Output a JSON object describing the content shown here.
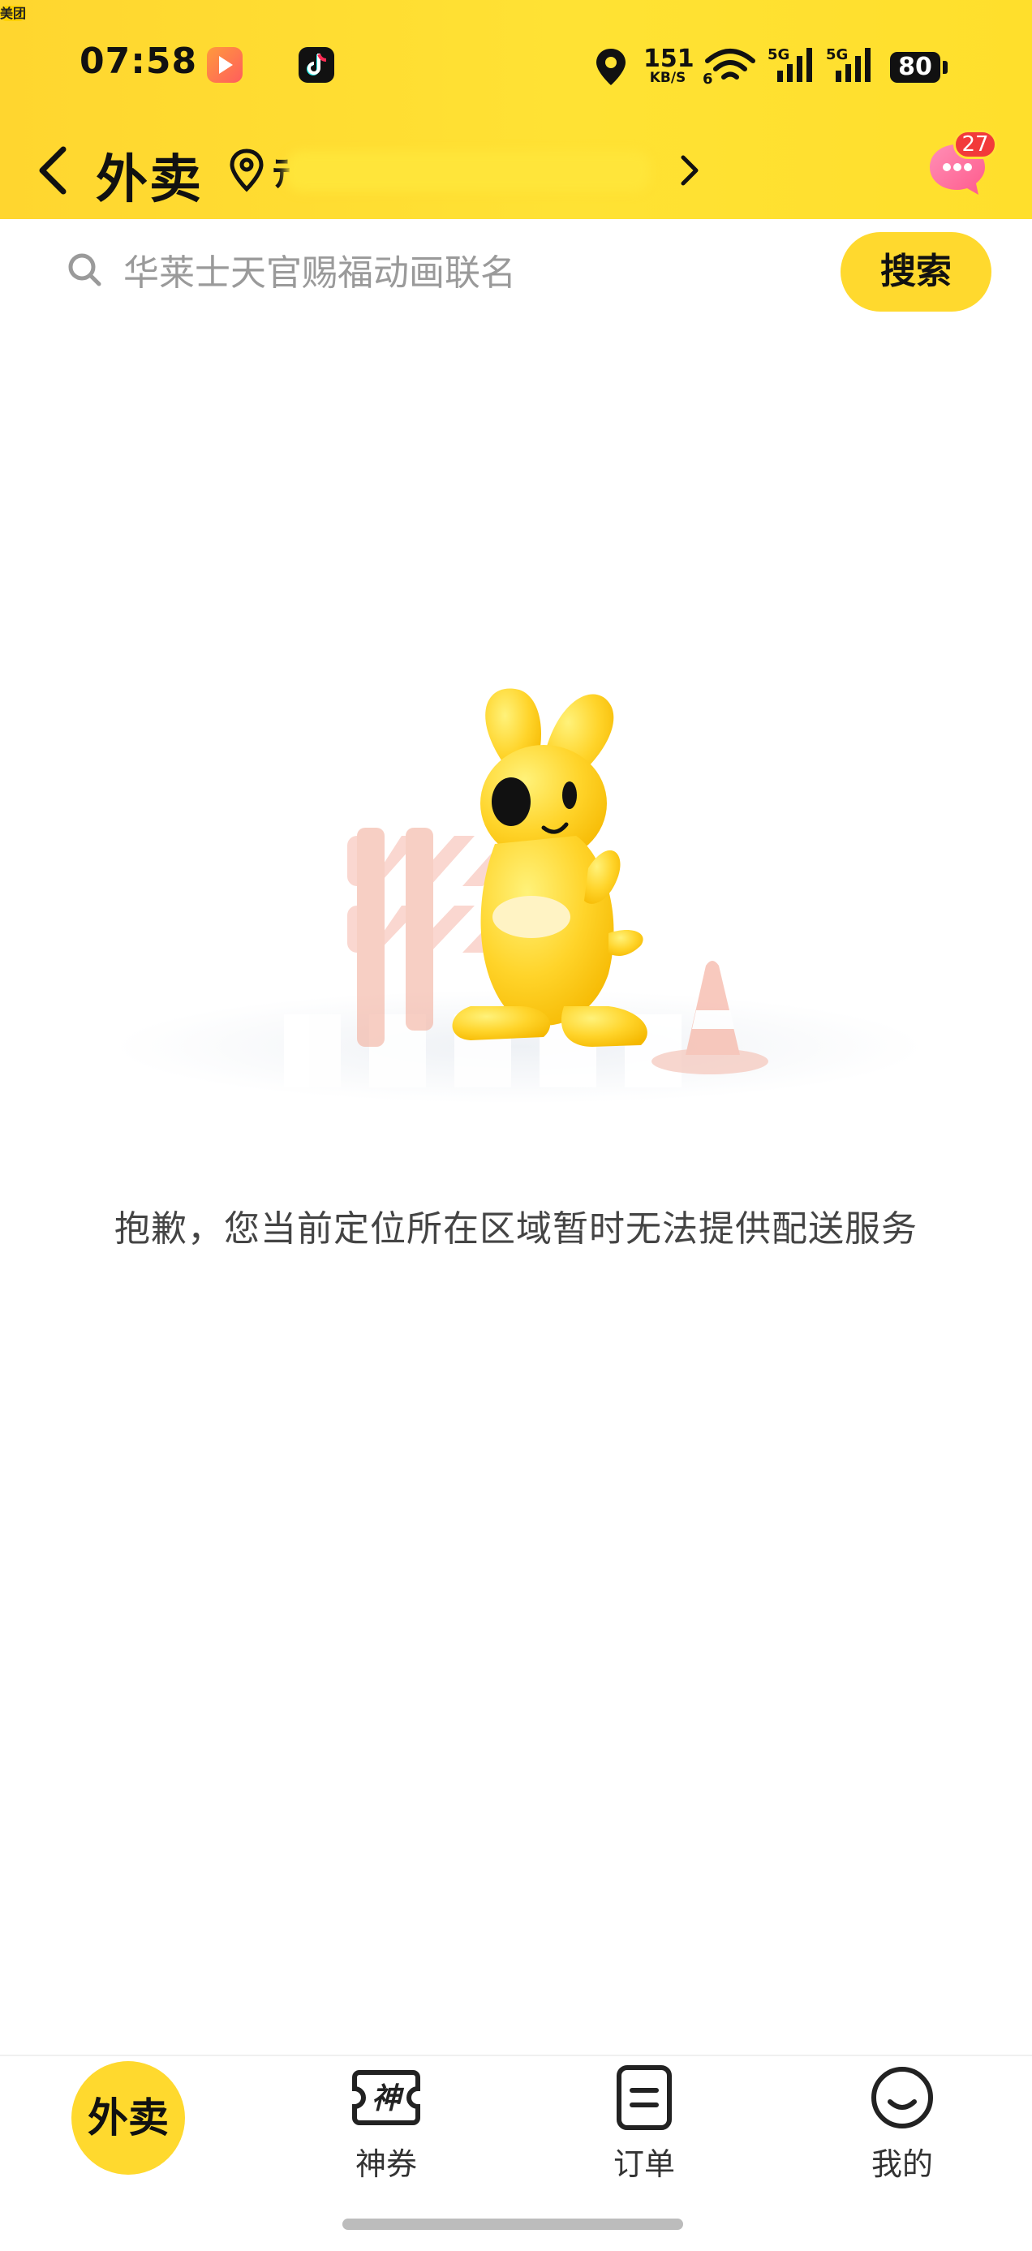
{
  "status_bar": {
    "time": "07:58",
    "apps": [
      "video-app-icon",
      "美团",
      "tiktok-icon"
    ],
    "net_speed_value": "151",
    "net_speed_unit": "KB/S",
    "wifi_label": "6",
    "sim1_label": "5G",
    "sim2_label": "5G",
    "battery": "80"
  },
  "nav": {
    "title": "外卖",
    "location_text": "ﾃ",
    "message_badge": "27"
  },
  "search": {
    "placeholder": "华莱士天官赐福动画联名",
    "button_label": "搜索"
  },
  "main": {
    "empty_message": "抱歉，您当前定位所在区域暂时无法提供配送服务"
  },
  "tabbar": {
    "home_label": "外卖",
    "tabs": [
      {
        "label": "神券",
        "icon": "coupon-icon"
      },
      {
        "label": "订单",
        "icon": "order-icon"
      },
      {
        "label": "我的",
        "icon": "profile-icon"
      }
    ]
  },
  "colors": {
    "brand_yellow": "#ffd92e",
    "badge_red": "#f23a3a"
  }
}
